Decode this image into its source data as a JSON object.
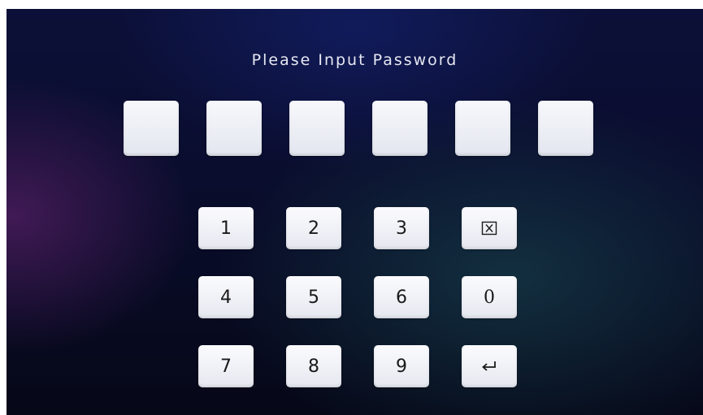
{
  "title": "Please Input Password",
  "password_slots": [
    "",
    "",
    "",
    "",
    "",
    ""
  ],
  "keypad": {
    "row1": [
      "1",
      "2",
      "3"
    ],
    "row2": [
      "4",
      "5",
      "6"
    ],
    "row3": [
      "7",
      "8",
      "9"
    ],
    "clear_icon": "clear-box-icon",
    "zero_label": "0",
    "enter_icon": "enter-return-icon"
  }
}
